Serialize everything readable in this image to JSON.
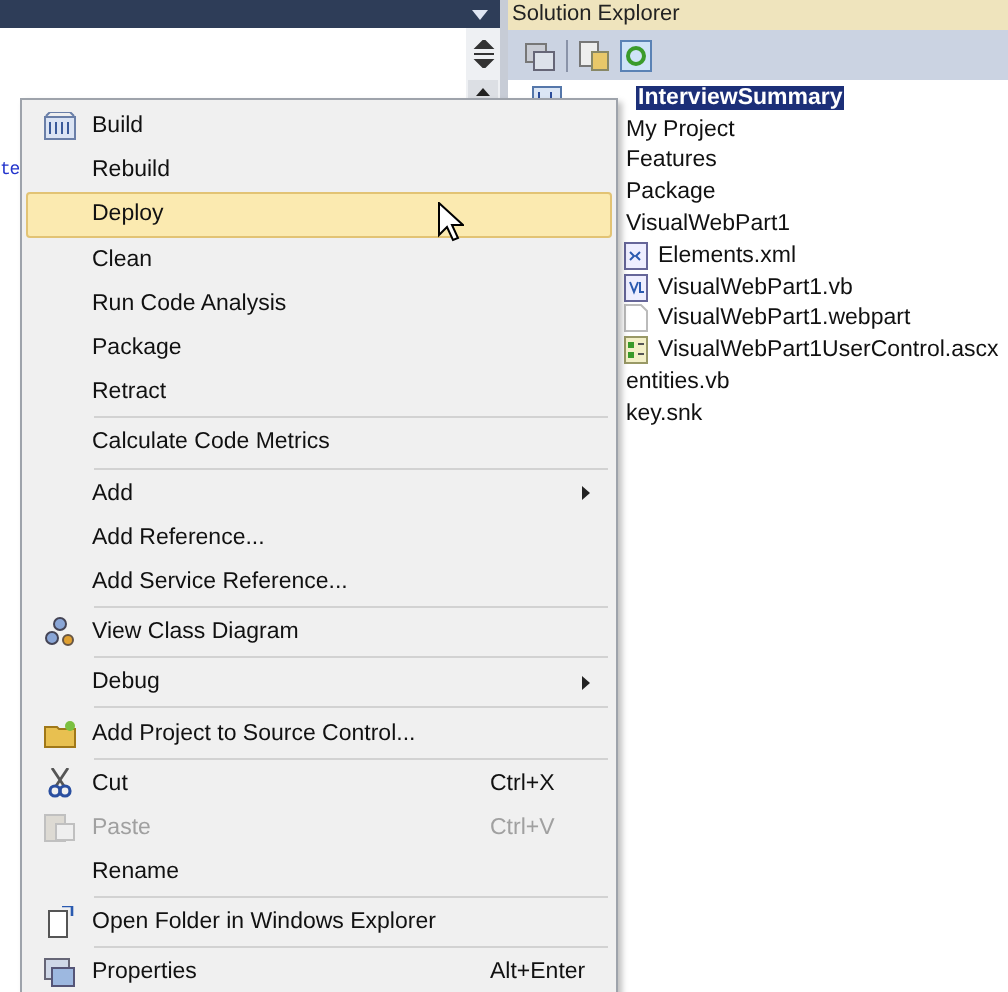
{
  "editor": {
    "code_fragment": "te"
  },
  "solution_explorer": {
    "title": "Solution Explorer",
    "tree": [
      {
        "kind": "project",
        "label": "InterviewSummary",
        "selected": true,
        "children": [
          {
            "label": "My Project",
            "selected": false
          },
          {
            "label": "Features",
            "selected": false
          },
          {
            "label": "Package",
            "selected": false
          },
          {
            "label": "VisualWebPart1",
            "selected": false,
            "children": [
              {
                "kind": "xml",
                "label": "Elements.xml",
                "selected": false
              },
              {
                "kind": "vb",
                "label": "VisualWebPart1.vb",
                "selected": false
              },
              {
                "kind": "file",
                "label": "VisualWebPart1.webpart",
                "selected": false
              },
              {
                "kind": "ascx",
                "label": "VisualWebPart1UserControl.ascx",
                "selected": false
              }
            ]
          },
          {
            "label": "entities.vb",
            "selected": false
          },
          {
            "label": "key.snk",
            "selected": false
          }
        ]
      }
    ]
  },
  "context_menu": [
    {
      "kind": "build",
      "label": "Build",
      "selected": false,
      "disabled": false
    },
    {
      "kind": "item",
      "label": "Rebuild",
      "selected": false,
      "disabled": false
    },
    {
      "kind": "item",
      "label": "Deploy",
      "selected": true,
      "disabled": false
    },
    {
      "kind": "item",
      "label": "Clean",
      "selected": false,
      "disabled": false
    },
    {
      "kind": "item",
      "label": "Run Code Analysis",
      "selected": false,
      "disabled": false
    },
    {
      "kind": "item",
      "label": "Package",
      "selected": false,
      "disabled": false
    },
    {
      "kind": "item",
      "label": "Retract",
      "selected": false,
      "disabled": false
    },
    {
      "kind": "separator"
    },
    {
      "kind": "item",
      "label": "Calculate Code Metrics",
      "selected": false,
      "disabled": false
    },
    {
      "kind": "separator"
    },
    {
      "kind": "item",
      "label": "Add",
      "submenu": true,
      "selected": false,
      "disabled": false
    },
    {
      "kind": "item",
      "label": "Add Reference...",
      "selected": false,
      "disabled": false
    },
    {
      "kind": "item",
      "label": "Add Service Reference...",
      "selected": false,
      "disabled": false
    },
    {
      "kind": "separator"
    },
    {
      "kind": "diagram",
      "label": "View Class Diagram",
      "selected": false,
      "disabled": false
    },
    {
      "kind": "separator"
    },
    {
      "kind": "item",
      "label": "Debug",
      "submenu": true,
      "selected": false,
      "disabled": false
    },
    {
      "kind": "separator"
    },
    {
      "kind": "folder",
      "label": "Add Project to Source Control...",
      "selected": false,
      "disabled": false
    },
    {
      "kind": "separator"
    },
    {
      "kind": "cut",
      "label": "Cut",
      "shortcut": "Ctrl+X",
      "selected": false,
      "disabled": false
    },
    {
      "kind": "paste",
      "label": "Paste",
      "shortcut": "Ctrl+V",
      "selected": false,
      "disabled": true
    },
    {
      "kind": "item",
      "label": "Rename",
      "selected": false,
      "disabled": false
    },
    {
      "kind": "separator"
    },
    {
      "kind": "open-folder",
      "label": "Open Folder in Windows Explorer",
      "selected": false,
      "disabled": false
    },
    {
      "kind": "separator"
    },
    {
      "kind": "properties",
      "label": "Properties",
      "shortcut": "Alt+Enter",
      "selected": false,
      "disabled": false
    }
  ]
}
